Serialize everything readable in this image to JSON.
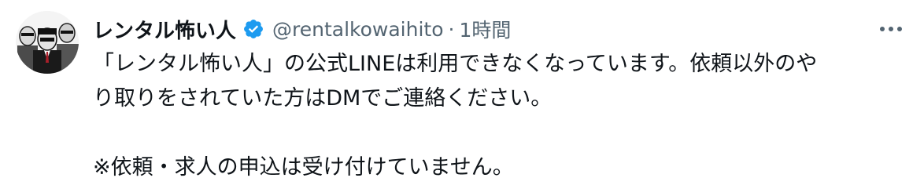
{
  "tweet": {
    "display_name": "レンタル怖い人",
    "handle": "@rentalkowaihito",
    "separator": "·",
    "time": "1時間",
    "verified_icon": "verified-badge-icon",
    "more_icon": "more-horizontal-icon",
    "text_lines": [
      "「レンタル怖い人」の公式LINEは利用できなくなっています。依頼以外のや",
      "り取りをされていた方はDMでご連絡ください。",
      "※依頼・求人の申込は受け付けていません。"
    ]
  },
  "colors": {
    "text": "#0f1419",
    "muted": "#536471",
    "verified": "#1d9bf0"
  }
}
